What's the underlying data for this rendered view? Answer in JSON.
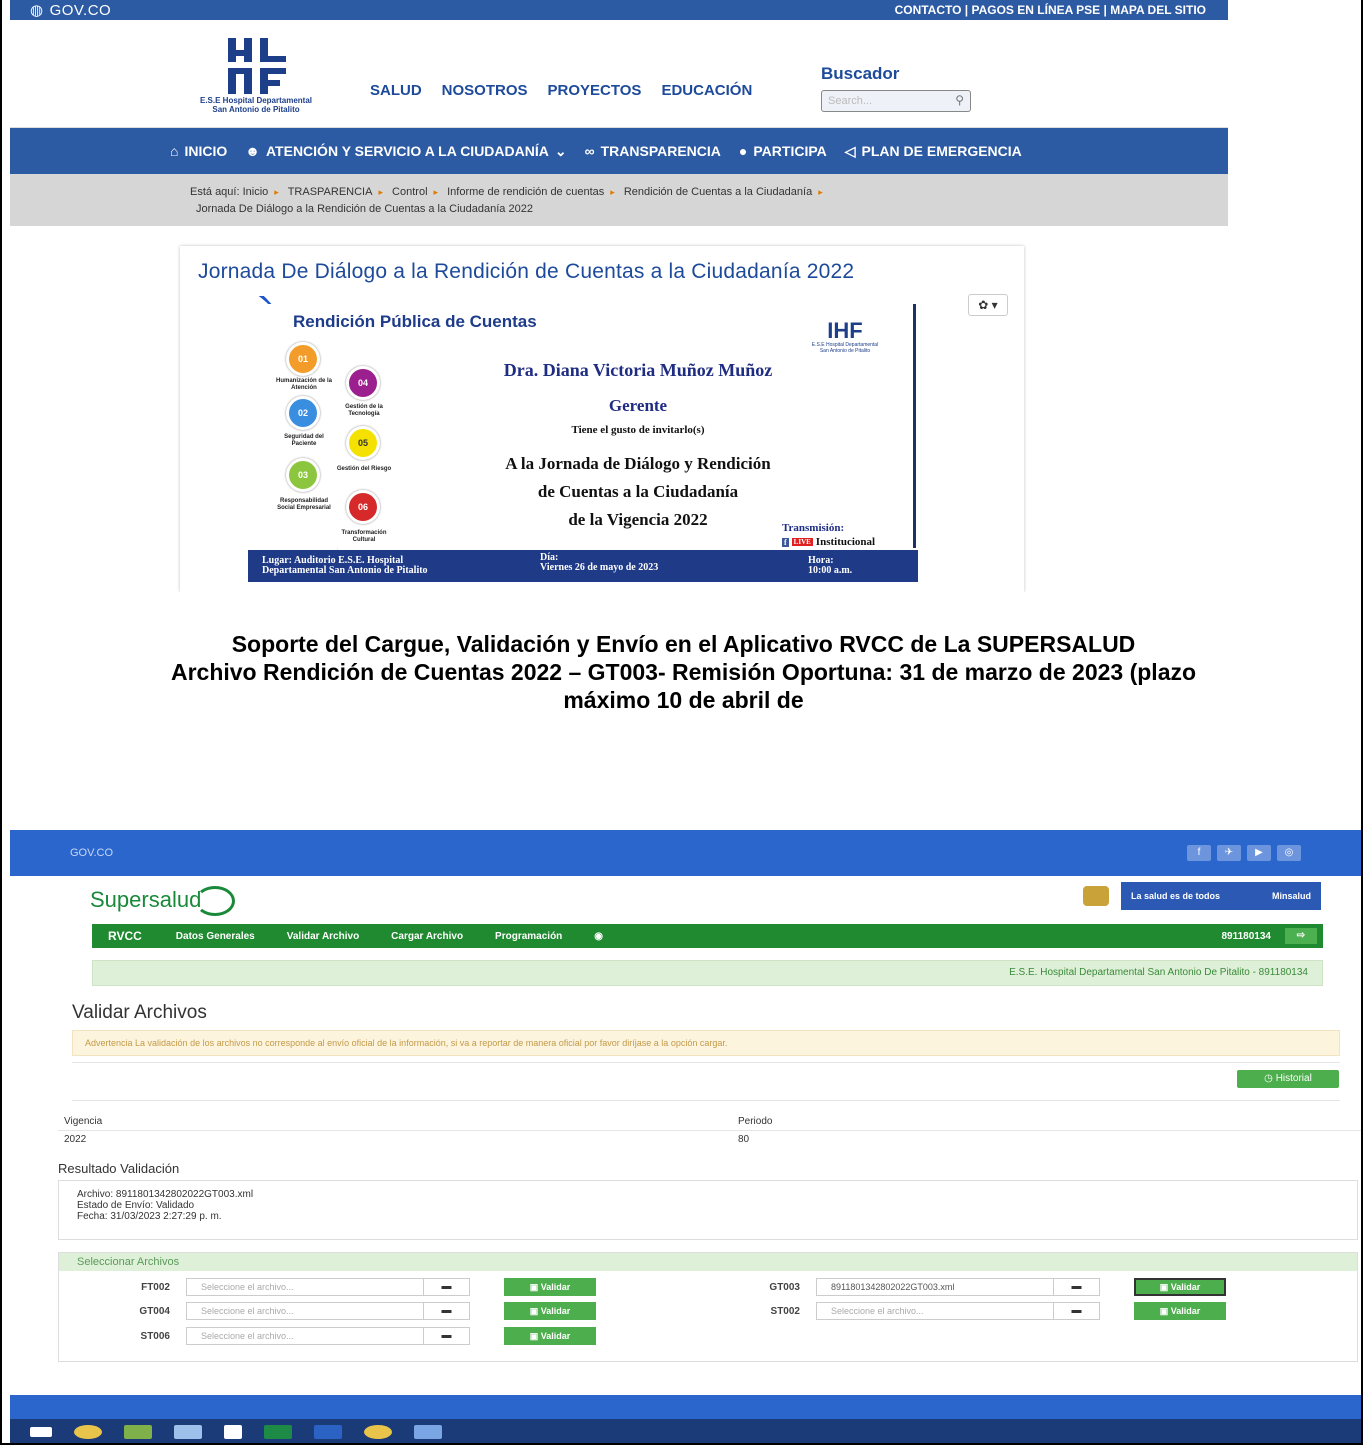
{
  "top": {
    "gov_label": "GOV.CO",
    "top_links": "CONTACTO | PAGOS EN LÍNEA PSE | MAPA DEL SITIO",
    "logo_caption_1": "E.S.E Hospital Departamental",
    "logo_caption_2": "San Antonio de Pitalito",
    "main_nav": [
      "SALUD",
      "NOSOTROS",
      "PROYECTOS",
      "EDUCACIÓN"
    ],
    "search_label": "Buscador",
    "search_placeholder": "Search...",
    "nav": [
      "INICIO",
      "ATENCIÓN Y SERVICIO A LA CIUDADANÍA",
      "TRANSPARENCIA",
      "PARTICIPA",
      "PLAN DE EMERGENCIA"
    ],
    "breadcrumb_prefix": "Está aquí:",
    "breadcrumb": [
      "Inicio",
      "TRASPARENCIA",
      "Control",
      "Informe de rendición de cuentas",
      "Rendición de Cuentas a la Ciudadanía"
    ],
    "breadcrumb_last": "Jornada De Diálogo a la Rendición de Cuentas a la Ciudadanía 2022",
    "article_title": "Jornada De Diálogo a la Rendición de Cuentas a la Ciudadanía 2022",
    "flyer": {
      "title": "Rendición Pública de Cuentas",
      "name": "Dra. Diana Victoria Muñoz Muñoz",
      "role": "Gerente",
      "invite": "Tiene el gusto de invitarlo(s)",
      "line1": "A la Jornada de Diálogo y Rendición",
      "line2": "de Cuentas a la Ciudadanía",
      "line3": "de la Vigencia 2022",
      "transmision": "Transmisión:",
      "institucional": "Institucional",
      "live": "LIVE",
      "logo_caption": "E.S.E Hospital Departamental San Antonio de Pitalito",
      "items": [
        {
          "num": "01",
          "label": "Humanización de la Atención",
          "color": "#f39c2a"
        },
        {
          "num": "02",
          "label": "Seguridad del Paciente",
          "color": "#3a8ee0"
        },
        {
          "num": "03",
          "label": "Responsabilidad Social Empresarial",
          "color": "#8cc63f"
        },
        {
          "num": "04",
          "label": "Gestión de la Tecnología",
          "color": "#9c1f8f"
        },
        {
          "num": "05",
          "label": "Gestión del Riesgo",
          "color": "#f5e100"
        },
        {
          "num": "06",
          "label": "Transformación Cultural",
          "color": "#d62a2a"
        }
      ],
      "lugar": "Lugar: Auditorio E.S.E. Hospital",
      "lugar2": "Departamental San Antonio de Pitalito",
      "dia": "Día:",
      "dia2": "Viernes 26 de mayo de 2023",
      "hora": "Hora:",
      "hora2": "10:00 a.m."
    }
  },
  "caption": {
    "line1": "Soporte del Cargue, Validación y Envío en el Aplicativo RVCC de La SUPERSALUD",
    "line2": "Archivo Rendición de Cuentas 2022 – GT003- Remisión Oportuna: 31 de marzo de 2023 (plazo",
    "line3": "máximo 10 de abril de"
  },
  "bottom": {
    "gov_label": "GOV.CO",
    "logo_text": "Supersalud",
    "min_text": "La salud es de todos",
    "min_text2": "Minsalud",
    "nav": [
      "RVCC",
      "Datos Generales",
      "Validar Archivo",
      "Cargar Archivo",
      "Programación"
    ],
    "nit": "891180134",
    "entity": "E.S.E. Hospital Departamental San Antonio De Pitalito - 891180134",
    "page_title": "Validar Archivos",
    "warning": "Advertencia La validación de los archivos no corresponde al envío oficial de la información, si va a reportar de manera oficial por favor diríjase a la opción cargar.",
    "history": "Historial",
    "vigencia_label": "Vigencia",
    "vigencia_value": "2022",
    "periodo_label": "Periodo",
    "periodo_value": "80",
    "result_title": "Resultado Validación",
    "result_file": "Archivo: 8911801342802022GT003.xml",
    "result_status": "Estado de Envío: Validado",
    "result_date": "Fecha: 31/03/2023 2:27:29 p. m.",
    "select_title": "Seleccionar Archivos",
    "file_placeholder": "Seleccione el archivo...",
    "validate_label": "Validar",
    "files": [
      {
        "code": "FT002",
        "value": ""
      },
      {
        "code": "GT003",
        "value": "8911801342802022GT003.xml"
      },
      {
        "code": "GT004",
        "value": ""
      },
      {
        "code": "ST002",
        "value": ""
      },
      {
        "code": "ST006",
        "value": ""
      }
    ]
  }
}
